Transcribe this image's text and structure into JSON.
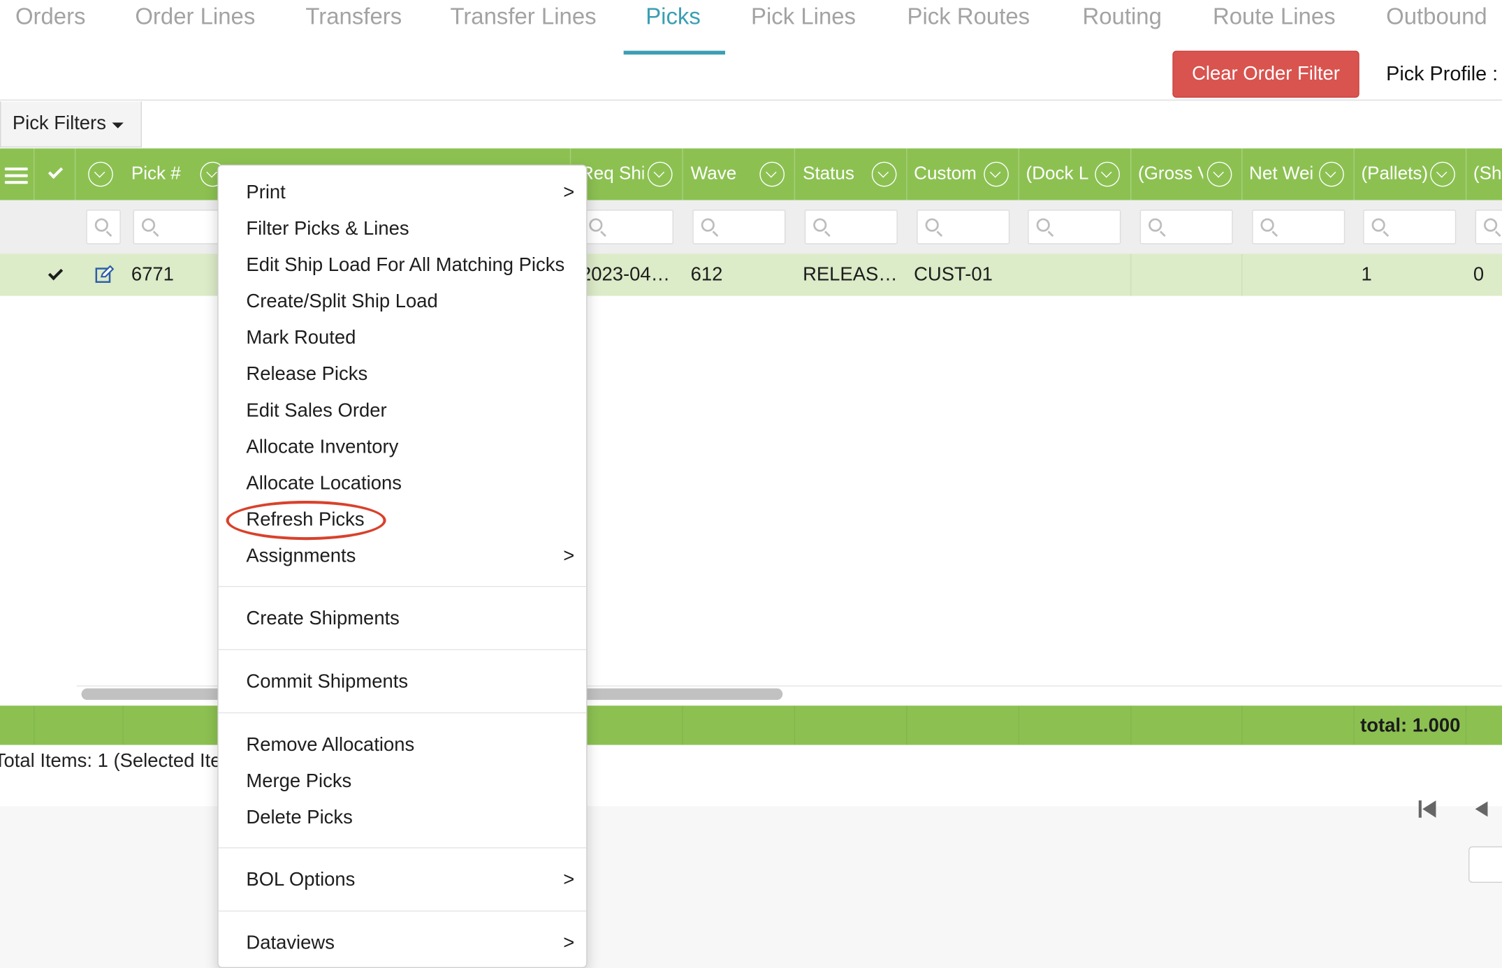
{
  "tabs": [
    {
      "label": "Orders"
    },
    {
      "label": "Order Lines"
    },
    {
      "label": "Transfers"
    },
    {
      "label": "Transfer Lines"
    },
    {
      "label": "Picks",
      "active": true
    },
    {
      "label": "Pick Lines"
    },
    {
      "label": "Pick Routes"
    },
    {
      "label": "Routing"
    },
    {
      "label": "Route Lines"
    },
    {
      "label": "Outbound"
    }
  ],
  "toolbar": {
    "clear_order_filter": "Clear Order Filter",
    "pick_profile_label": "Pick Profile :",
    "pick_filters_label": "Pick Filters"
  },
  "grid": {
    "columns": [
      {
        "label": "Pick #"
      },
      {
        "label": "Req Shi"
      },
      {
        "label": "Wave"
      },
      {
        "label": "Status"
      },
      {
        "label": "Custom"
      },
      {
        "label": "(Dock L"
      },
      {
        "label": "(Gross V"
      },
      {
        "label": "Net Wei"
      },
      {
        "label": "(Pallets)"
      },
      {
        "label": "(She"
      }
    ],
    "row": {
      "pick_no": "6771",
      "req_ship": "2023-04…",
      "wave": "612",
      "status": "RELEAS…",
      "customer": "CUST-01",
      "pallets": "1",
      "she": "0"
    },
    "footer_total": "total: 1.000",
    "items_summary": "Total Items: 1 (Selected Ite"
  },
  "context_menu": {
    "items": [
      {
        "label": "Print",
        "submenu": true
      },
      {
        "label": "Filter Picks & Lines"
      },
      {
        "label": "Edit Ship Load For All Matching Picks"
      },
      {
        "label": "Create/Split Ship Load"
      },
      {
        "label": "Mark Routed"
      },
      {
        "label": "Release Picks"
      },
      {
        "label": "Edit Sales Order"
      },
      {
        "label": "Allocate Inventory"
      },
      {
        "label": "Allocate Locations"
      },
      {
        "label": "Refresh Picks",
        "highlighted": true
      },
      {
        "label": "Assignments",
        "submenu": true
      },
      {
        "label": "Create Shipments"
      },
      {
        "label": "Commit Shipments"
      },
      {
        "label": "Remove Allocations"
      },
      {
        "label": "Merge Picks"
      },
      {
        "label": "Delete Picks"
      },
      {
        "label": "BOL Options",
        "submenu": true
      },
      {
        "label": "Dataviews",
        "submenu": true
      }
    ],
    "submenu_arrow": ">"
  },
  "colors": {
    "accent_tab": "#3b9fb3",
    "grid_green": "#8cc152",
    "row_selected": "#dcebc8",
    "danger": "#d9534f",
    "highlight_ring": "#d9412b"
  },
  "icons": [
    "hamburger-icon",
    "checkmark-icon",
    "chevron-down-icon",
    "search-icon",
    "edit-icon",
    "pager-first-icon",
    "pager-prev-icon"
  ]
}
